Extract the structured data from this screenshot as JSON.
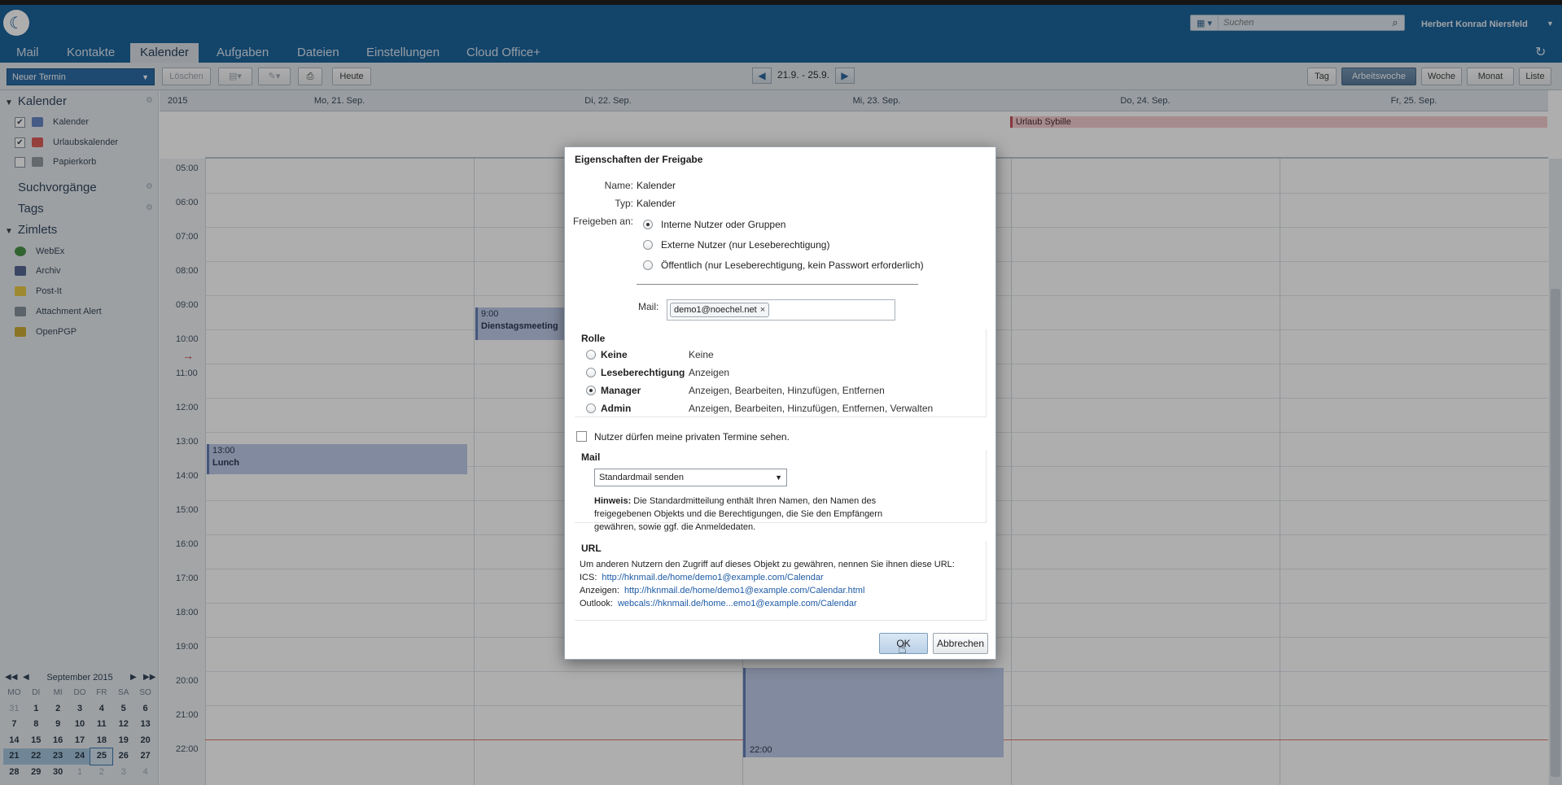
{
  "topbar": {
    "search_placeholder": "Suchen",
    "user_name": "Herbert Konrad Niersfeld",
    "tabs": [
      "Mail",
      "Kontakte",
      "Kalender",
      "Aufgaben",
      "Dateien",
      "Einstellungen",
      "Cloud Office+"
    ],
    "active_tab": "Kalender"
  },
  "toolbar": {
    "new_appointment": "Neuer Termin",
    "delete": "Löschen",
    "today": "Heute",
    "date_range": "21.9. - 25.9.",
    "views": [
      "Tag",
      "Arbeitswoche",
      "Woche",
      "Monat",
      "Liste"
    ],
    "active_view": "Arbeitswoche"
  },
  "sidebar": {
    "calendars_header": "Kalender",
    "calendars": [
      {
        "label": "Kalender",
        "checked": true
      },
      {
        "label": "Urlaubskalender",
        "checked": true
      },
      {
        "label": "Papierkorb",
        "checked": false
      }
    ],
    "searches_header": "Suchvorgänge",
    "tags_header": "Tags",
    "zimlets_header": "Zimlets",
    "zimlets": [
      "WebEx",
      "Archiv",
      "Post-It",
      "Attachment Alert",
      "OpenPGP"
    ]
  },
  "minical": {
    "month": "September 2015",
    "dow": [
      "MO",
      "DI",
      "MI",
      "DO",
      "FR",
      "SA",
      "SO"
    ],
    "weeks": [
      [
        "31",
        "1",
        "2",
        "3",
        "4",
        "5",
        "6"
      ],
      [
        "7",
        "8",
        "9",
        "10",
        "11",
        "12",
        "13"
      ],
      [
        "14",
        "15",
        "16",
        "17",
        "18",
        "19",
        "20"
      ],
      [
        "21",
        "22",
        "23",
        "24",
        "25",
        "26",
        "27"
      ],
      [
        "28",
        "29",
        "30",
        "1",
        "2",
        "3",
        "4"
      ]
    ]
  },
  "calendar": {
    "year": "2015",
    "days": [
      "Mo, 21. Sep.",
      "Di, 22. Sep.",
      "Mi, 23. Sep.",
      "Do, 24. Sep.",
      "Fr, 25. Sep."
    ],
    "hours": [
      "05:00",
      "06:00",
      "07:00",
      "08:00",
      "09:00",
      "10:00",
      "11:00",
      "12:00",
      "13:00",
      "14:00",
      "15:00",
      "16:00",
      "17:00",
      "18:00",
      "19:00",
      "20:00",
      "21:00",
      "22:00"
    ],
    "allday_event": "Urlaub Sybille",
    "events": [
      {
        "time": "9:00",
        "title": "Dienstagsmeeting"
      },
      {
        "time": "13:00",
        "title": "Lunch"
      },
      {
        "time": "22:00",
        "title": ""
      }
    ]
  },
  "dialog": {
    "title": "Eigenschaften der Freigabe",
    "name_label": "Name:",
    "name_value": "Kalender",
    "type_label": "Typ:",
    "type_value": "Kalender",
    "share_with_label": "Freigeben an:",
    "share_options": [
      "Interne Nutzer oder Gruppen",
      "Externe Nutzer (nur Leseberechtigung)",
      "Öffentlich (nur Leseberechtigung, kein Passwort erforderlich)"
    ],
    "share_selected": 0,
    "mail_label": "Mail:",
    "mail_chip": "demo1@noechel.net",
    "role_header": "Rolle",
    "roles": [
      {
        "name": "Keine",
        "desc": "Keine"
      },
      {
        "name": "Leseberechtigung",
        "desc": "Anzeigen"
      },
      {
        "name": "Manager",
        "desc": "Anzeigen, Bearbeiten, Hinzufügen, Entfernen"
      },
      {
        "name": "Admin",
        "desc": "Anzeigen, Bearbeiten, Hinzufügen, Entfernen, Verwalten"
      }
    ],
    "role_selected": 2,
    "private_checkbox": "Nutzer dürfen meine privaten Termine sehen.",
    "mail_header": "Mail",
    "mail_select": "Standardmail senden",
    "hint_label": "Hinweis:",
    "hint_text": "Die Standardmitteilung enthält Ihren Namen, den Namen des freigegebenen Objekts und die Berechtigungen, die Sie den Empfängern gewähren, sowie ggf. die Anmeldedaten.",
    "url_header": "URL",
    "url_intro": "Um anderen Nutzern den Zugriff auf dieses Objekt zu gewähren, nennen Sie ihnen diese URL:",
    "urls": [
      {
        "label": "ICS:",
        "link": "http://hknmail.de/home/demo1@example.com/Calendar"
      },
      {
        "label": "Anzeigen:",
        "link": "http://hknmail.de/home/demo1@example.com/Calendar.html"
      },
      {
        "label": "Outlook:",
        "link": "webcals://hknmail.de/home...emo1@example.com/Calendar"
      }
    ],
    "ok": "OK",
    "cancel": "Abbrechen"
  }
}
